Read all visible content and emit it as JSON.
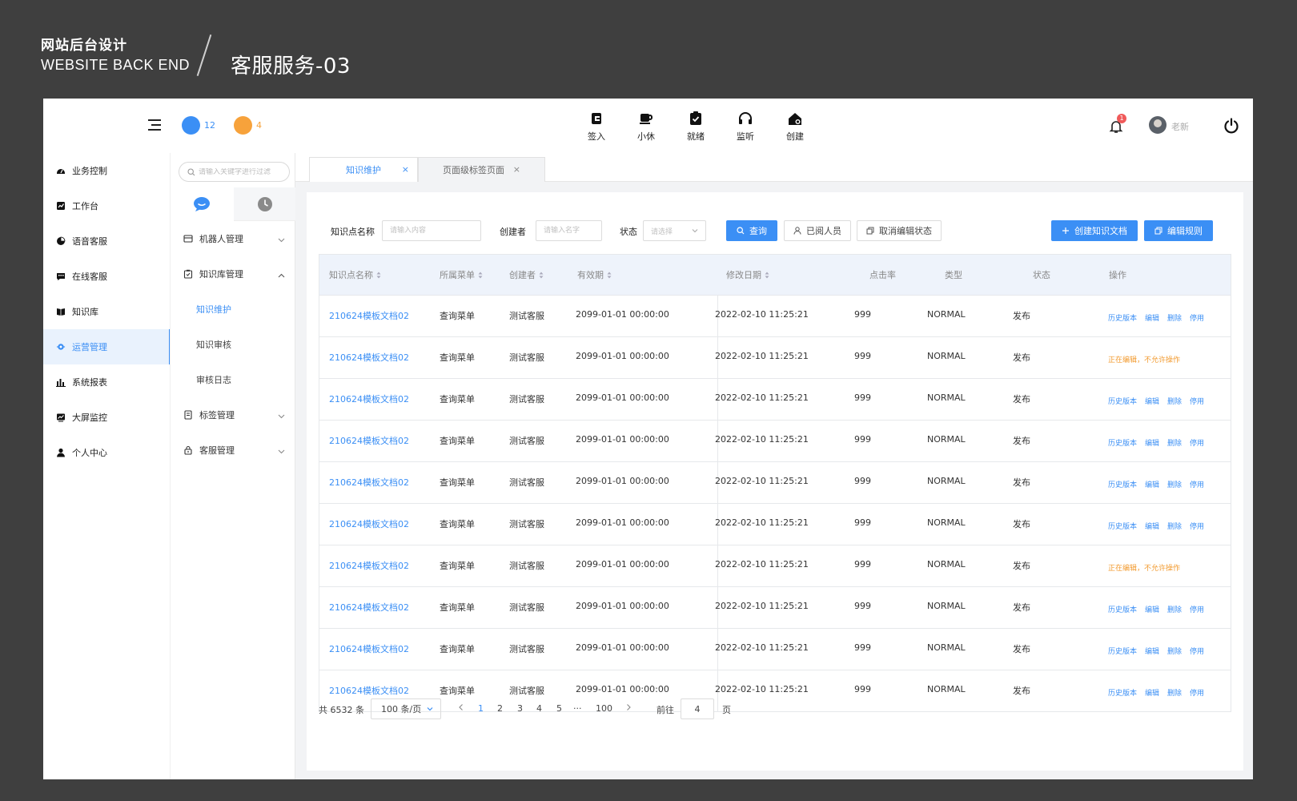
{
  "banner": {
    "title_cn": "网站后台设计",
    "title_en": "WEBSITE BACK END",
    "page_title": "客服服务-03"
  },
  "topbar": {
    "counters": [
      {
        "value": "12",
        "color": "#3b8ff5"
      },
      {
        "value": "4",
        "color": "#f7a23b"
      }
    ],
    "actions": [
      {
        "label": "签入",
        "icon": "sign-in-icon"
      },
      {
        "label": "小休",
        "icon": "coffee-cup-icon"
      },
      {
        "label": "就绪",
        "icon": "clipboard-check-icon"
      },
      {
        "label": "监听",
        "icon": "headset-icon"
      },
      {
        "label": "创建",
        "icon": "home-create-icon"
      }
    ],
    "notification_count": "1",
    "user_name": "老新"
  },
  "leftnav": {
    "items": [
      {
        "label": "业务控制",
        "icon": "dashboard-icon"
      },
      {
        "label": "工作台",
        "icon": "workbench-icon"
      },
      {
        "label": "语音客服",
        "icon": "pie-icon"
      },
      {
        "label": "在线客服",
        "icon": "chat-icon"
      },
      {
        "label": "知识库",
        "icon": "book-icon"
      },
      {
        "label": "运营管理",
        "icon": "operations-icon",
        "active": true
      },
      {
        "label": "系统报表",
        "icon": "bar-chart-icon"
      },
      {
        "label": "大屏监控",
        "icon": "monitor-icon"
      },
      {
        "label": "个人中心",
        "icon": "user-icon"
      }
    ]
  },
  "subnav": {
    "search_placeholder": "请输入关键字进行过滤",
    "groups": {
      "robot": "机器人管理",
      "knowledge": "知识库管理",
      "leaf_maintain": "知识维护",
      "leaf_review": "知识审核",
      "leaf_log": "审核日志",
      "tags": "标签管理",
      "agents": "客服管理"
    }
  },
  "tabs": [
    {
      "label": "知识维护",
      "close": "×"
    },
    {
      "label": "页面级标签页面",
      "close": "×"
    }
  ],
  "filters": {
    "name_label": "知识点名称",
    "name_placeholder": "请输入内容",
    "creator_label": "创建者",
    "creator_placeholder": "请输入名字",
    "status_label": "状态",
    "status_placeholder": "请选择",
    "query_btn": "查询",
    "readers_btn": "已阅人员",
    "cancel_edit_btn": "取消编辑状态",
    "create_btn": "创建知识文档",
    "rules_btn": "编辑规则"
  },
  "table": {
    "columns": [
      "知识点名称",
      "所属菜单",
      "创建者",
      "有效期",
      "修改日期",
      "点击率",
      "类型",
      "状态",
      "操作"
    ],
    "rows": [
      {
        "name": "210624模板文档02",
        "menu": "查询菜单",
        "creator": "测试客服",
        "expire": "2099-01-01 00:00:00",
        "modified": "2022-02-10 11:25:21",
        "clicks": "999",
        "type": "NORMAL",
        "status": "发布",
        "locked": false
      },
      {
        "name": "210624模板文档02",
        "menu": "查询菜单",
        "creator": "测试客服",
        "expire": "2099-01-01 00:00:00",
        "modified": "2022-02-10 11:25:21",
        "clicks": "999",
        "type": "NORMAL",
        "status": "发布",
        "locked": true
      },
      {
        "name": "210624模板文档02",
        "menu": "查询菜单",
        "creator": "测试客服",
        "expire": "2099-01-01 00:00:00",
        "modified": "2022-02-10 11:25:21",
        "clicks": "999",
        "type": "NORMAL",
        "status": "发布",
        "locked": false
      },
      {
        "name": "210624模板文档02",
        "menu": "查询菜单",
        "creator": "测试客服",
        "expire": "2099-01-01 00:00:00",
        "modified": "2022-02-10 11:25:21",
        "clicks": "999",
        "type": "NORMAL",
        "status": "发布",
        "locked": false
      },
      {
        "name": "210624模板文档02",
        "menu": "查询菜单",
        "creator": "测试客服",
        "expire": "2099-01-01 00:00:00",
        "modified": "2022-02-10 11:25:21",
        "clicks": "999",
        "type": "NORMAL",
        "status": "发布",
        "locked": false
      },
      {
        "name": "210624模板文档02",
        "menu": "查询菜单",
        "creator": "测试客服",
        "expire": "2099-01-01 00:00:00",
        "modified": "2022-02-10 11:25:21",
        "clicks": "999",
        "type": "NORMAL",
        "status": "发布",
        "locked": false
      },
      {
        "name": "210624模板文档02",
        "menu": "查询菜单",
        "creator": "测试客服",
        "expire": "2099-01-01 00:00:00",
        "modified": "2022-02-10 11:25:21",
        "clicks": "999",
        "type": "NORMAL",
        "status": "发布",
        "locked": true
      },
      {
        "name": "210624模板文档02",
        "menu": "查询菜单",
        "creator": "测试客服",
        "expire": "2099-01-01 00:00:00",
        "modified": "2022-02-10 11:25:21",
        "clicks": "999",
        "type": "NORMAL",
        "status": "发布",
        "locked": false
      },
      {
        "name": "210624模板文档02",
        "menu": "查询菜单",
        "creator": "测试客服",
        "expire": "2099-01-01 00:00:00",
        "modified": "2022-02-10 11:25:21",
        "clicks": "999",
        "type": "NORMAL",
        "status": "发布",
        "locked": false
      },
      {
        "name": "210624模板文档02",
        "menu": "查询菜单",
        "creator": "测试客服",
        "expire": "2099-01-01 00:00:00",
        "modified": "2022-02-10 11:25:21",
        "clicks": "999",
        "type": "NORMAL",
        "status": "发布",
        "locked": false
      }
    ],
    "ops": [
      "历史版本",
      "编辑",
      "删除",
      "停用"
    ],
    "locked_text": "正在编辑，不允许操作"
  },
  "pagination": {
    "total": "共 6532 条",
    "page_size": "100 条/页",
    "pages": [
      "1",
      "2",
      "3",
      "4",
      "5",
      "···",
      "100"
    ],
    "current": "1",
    "goto_label": "前往",
    "goto_value": "4",
    "goto_suffix": "页"
  },
  "colors": {
    "accent": "#3b8ff5",
    "warning": "#f29a2e",
    "background": "#3f3f3f"
  }
}
